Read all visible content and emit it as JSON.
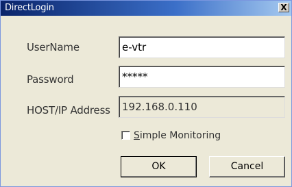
{
  "window": {
    "title": "DirectLogin",
    "close_glyph": "X"
  },
  "form": {
    "username_label": "UserName",
    "username_value": "e-vtr",
    "password_label": "Password",
    "password_value": "*****",
    "host_label": "HOST/IP Address",
    "host_value": "192.168.0.110",
    "monitoring_label_mnemonic": "S",
    "monitoring_label_rest": "imple Monitoring",
    "monitoring_checked": false
  },
  "buttons": {
    "ok_label": "OK",
    "cancel_label": "Cancel"
  },
  "colors": {
    "title_start": "#0a246a",
    "title_end": "#a6caf0",
    "dialog_bg": "#ece9d8"
  },
  "icons": {
    "close": "close-icon"
  }
}
